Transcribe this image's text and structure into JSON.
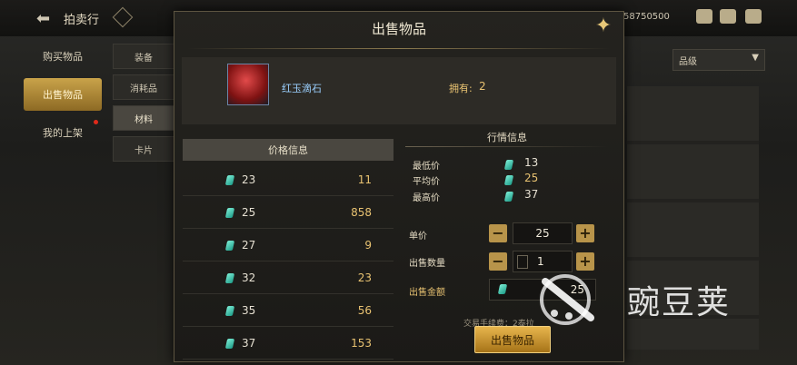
{
  "background": {
    "title": "拍卖行",
    "currency_value": "58750500",
    "nav": [
      {
        "label": "购买物品"
      },
      {
        "label": "出售物品"
      },
      {
        "label": "我的上架"
      }
    ],
    "categories": [
      "装备",
      "消耗品",
      "材料",
      "卡片"
    ],
    "filter_label": "品级"
  },
  "modal": {
    "title": "出售物品",
    "item": {
      "name": "红玉滴石",
      "own_label": "拥有:",
      "own_value": "2"
    },
    "price_info": {
      "header": "价格信息",
      "rows": [
        {
          "price": "23",
          "qty": "11"
        },
        {
          "price": "25",
          "qty": "858"
        },
        {
          "price": "27",
          "qty": "9"
        },
        {
          "price": "32",
          "qty": "23"
        },
        {
          "price": "35",
          "qty": "56"
        },
        {
          "price": "37",
          "qty": "153"
        }
      ]
    },
    "market": {
      "header": "行情信息",
      "min_label": "最低价",
      "min_value": "13",
      "avg_label": "平均价",
      "avg_value": "25",
      "max_label": "最高价",
      "max_value": "37"
    },
    "form": {
      "unit_price_label": "单价",
      "unit_price_value": "25",
      "qty_label": "出售数量",
      "qty_value": "1",
      "total_label": "出售金额",
      "total_value": "25",
      "fee_text": "交易手续费：2泰拉",
      "sell_button": "出售物品"
    }
  },
  "watermark": "豌豆荚",
  "colors": {
    "gold": "#e8c271",
    "accent_button": "#c9a34a",
    "gem": "#3fd3b8"
  }
}
